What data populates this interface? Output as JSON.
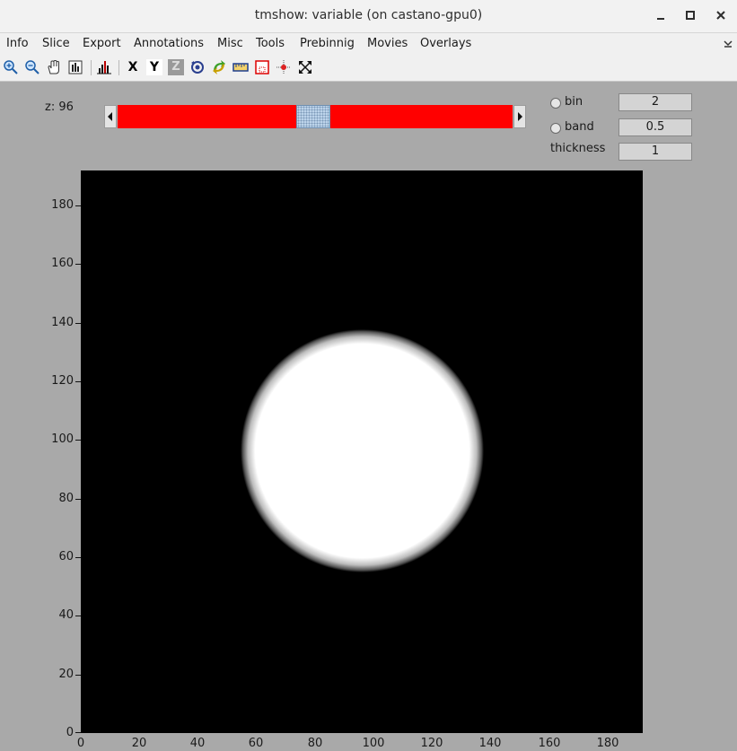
{
  "window": {
    "title": "tmshow: variable (on castano-gpu0)"
  },
  "menu": [
    "Info",
    "Slice",
    "Export",
    "Annotations",
    "Misc",
    "Tools",
    "Prebinnig",
    "Movies",
    "Overlays"
  ],
  "toolbar": {
    "icons": [
      "zoom-in-icon",
      "zoom-out-icon",
      "pan-hand-icon",
      "colorbar-icon",
      "histogram-icon",
      "x-axis-icon",
      "y-axis-icon",
      "z-axis-icon",
      "rotate-icon",
      "recycle-icon",
      "ruler-icon",
      "crop-icon",
      "crosshair-icon",
      "fit-icon"
    ],
    "x_label": "X",
    "y_label": "Y",
    "z_label": "Z"
  },
  "slice": {
    "label": "z: 96",
    "slider_fraction": 0.5
  },
  "options": {
    "bin_label": "bin",
    "bin_value": "2",
    "band_label": "band",
    "band_value": "0.5",
    "thickness_label": "thickness",
    "thickness_value": "1"
  },
  "axes": {
    "y_ticks": [
      "180",
      "160",
      "140",
      "120",
      "100",
      "80",
      "60",
      "40",
      "20",
      "0"
    ],
    "x_ticks": [
      "0",
      "20",
      "40",
      "60",
      "80",
      "100",
      "120",
      "140",
      "160",
      "180"
    ]
  },
  "colors": {
    "slider": "#ff0000",
    "background": "#a9a9a9"
  }
}
